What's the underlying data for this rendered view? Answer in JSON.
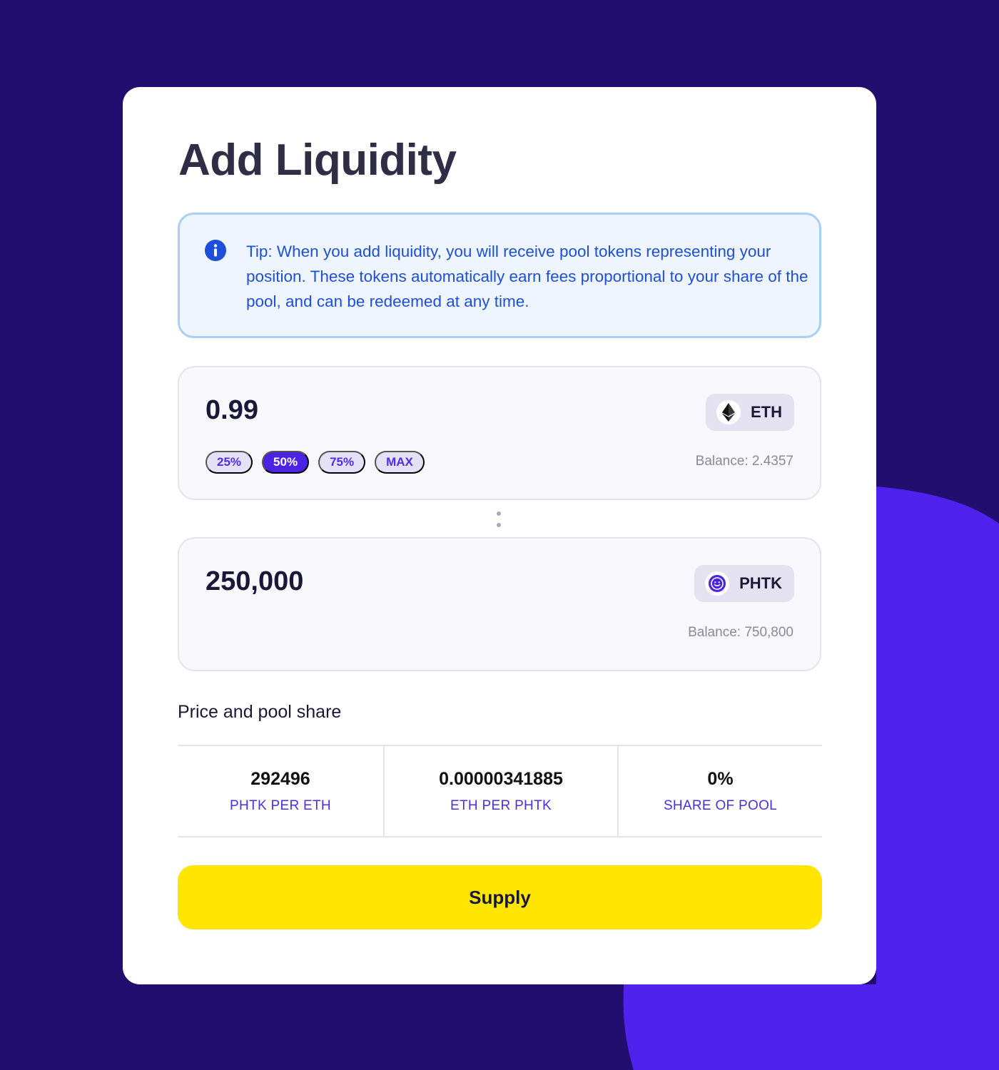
{
  "page": {
    "title": "Add Liquidity"
  },
  "tip": {
    "text": "Tip: When you add liquidity, you will receive pool tokens representing your position. These tokens automatically earn fees proportional to your share of the pool, and can be redeemed at any time."
  },
  "token_a": {
    "amount": "0.99",
    "symbol": "ETH",
    "balance": "Balance: 2.4357",
    "percent_options": [
      {
        "label": "25%",
        "active": false
      },
      {
        "label": "50%",
        "active": true
      },
      {
        "label": "75%",
        "active": false
      },
      {
        "label": "MAX",
        "active": false
      }
    ]
  },
  "token_b": {
    "amount": "250,000",
    "symbol": "PHTK",
    "balance": "Balance: 750,800"
  },
  "pool": {
    "section_label": "Price and pool share",
    "stats": [
      {
        "value": "292496",
        "caption": "PHTK PER ETH"
      },
      {
        "value": "0.00000341885",
        "caption": "ETH PER PHTK"
      },
      {
        "value": "0%",
        "caption": "SHARE OF POOL"
      }
    ]
  },
  "actions": {
    "supply_label": "Supply"
  },
  "colors": {
    "background": "#210e6e",
    "accent_blob": "#4f22ee",
    "primary": "#4a23e5",
    "supply_button": "#ffe500",
    "tip_text": "#1d4fd8"
  }
}
